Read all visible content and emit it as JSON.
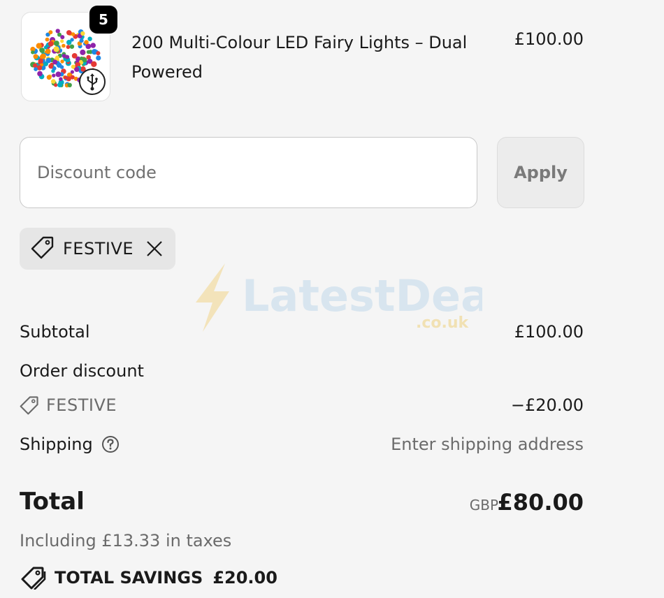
{
  "product": {
    "quantity": "5",
    "name": "200 Multi-Colour LED Fairy Lights – Dual Powered",
    "price": "£100.00",
    "image_icon": "fairy-lights-thumbnail",
    "badge_icon": "usb-icon"
  },
  "discount": {
    "placeholder": "Discount code",
    "apply_label": "Apply",
    "applied_code": "FESTIVE"
  },
  "watermark": {
    "text": "LatestDeals",
    "subtext": ".co.uk"
  },
  "summary": {
    "subtotal_label": "Subtotal",
    "subtotal_value": "£100.00",
    "order_discount_label": "Order discount",
    "discount_code": "FESTIVE",
    "discount_value": "−£20.00",
    "shipping_label": "Shipping",
    "shipping_value": "Enter shipping address",
    "total_label": "Total",
    "currency": "GBP",
    "total_value": "£80.00",
    "tax_note": "Including £13.33 in taxes",
    "savings_label": "TOTAL SAVINGS",
    "savings_value": "£20.00"
  },
  "colors": {
    "background": "#f5f5f5",
    "muted_text": "#6b6b6b",
    "chip_bg": "#e6e6e6"
  }
}
